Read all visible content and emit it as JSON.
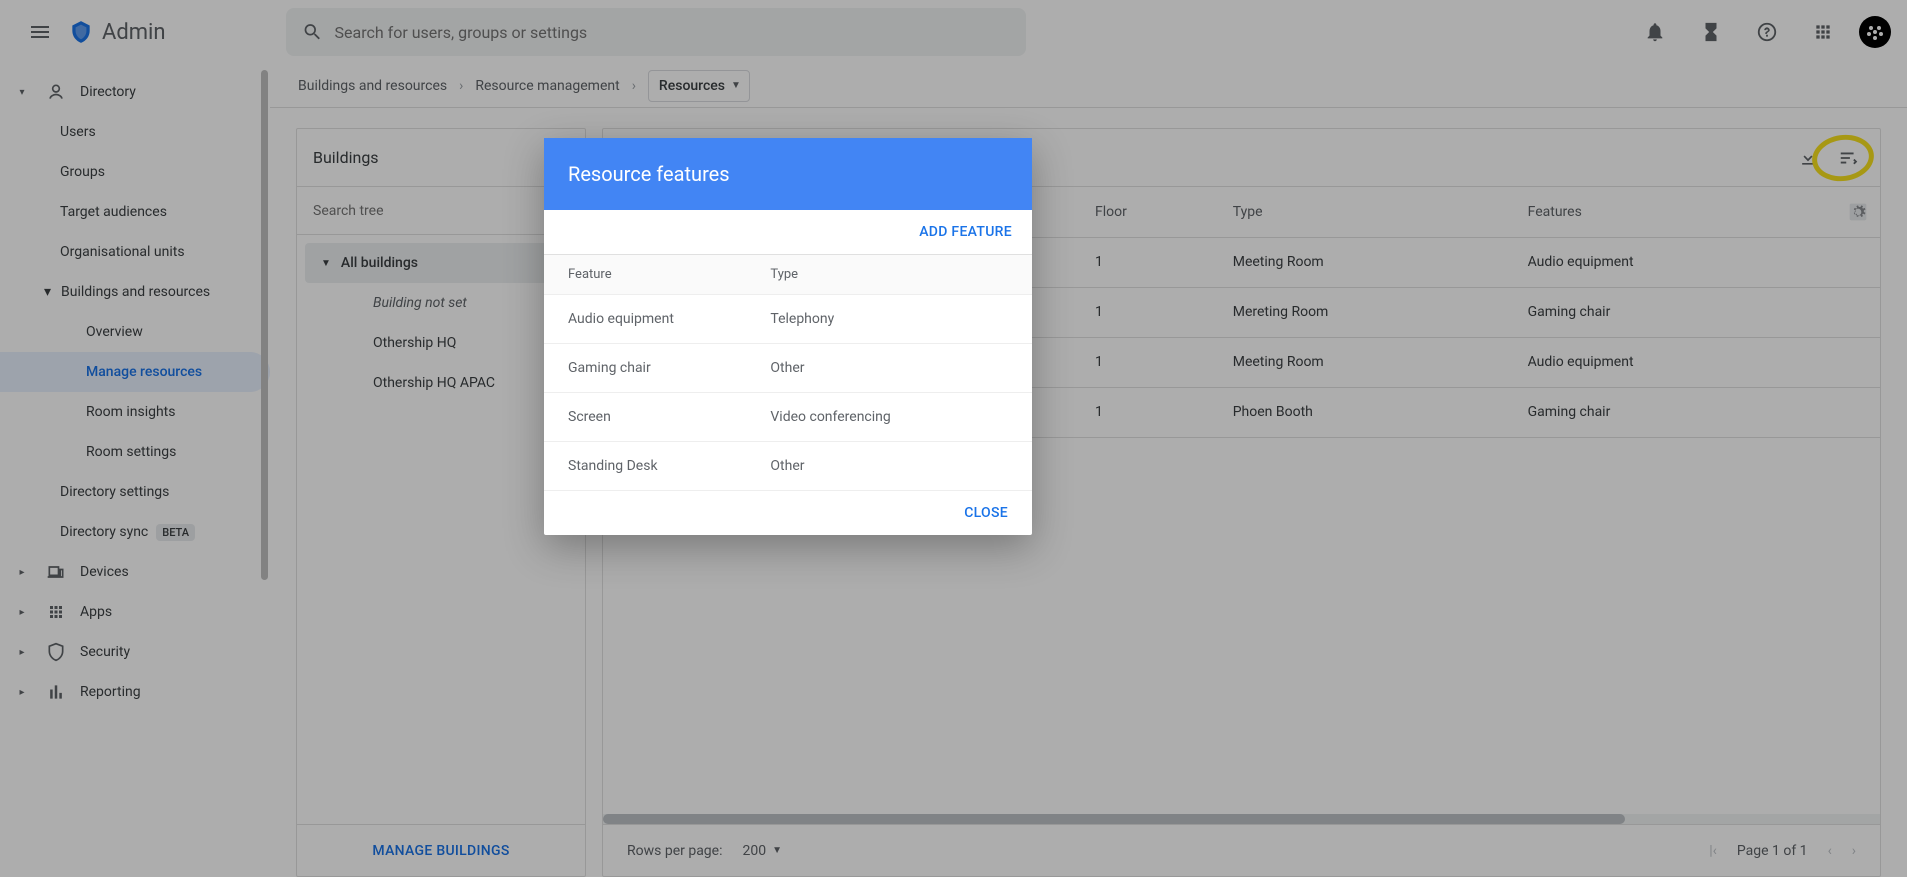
{
  "header": {
    "app_name": "Admin",
    "search_placeholder": "Search for users, groups or settings"
  },
  "sidebar": {
    "directory": "Directory",
    "users": "Users",
    "groups": "Groups",
    "target_audiences": "Target audiences",
    "org_units": "Organisational units",
    "buildings_resources": "Buildings and resources",
    "overview": "Overview",
    "manage_resources": "Manage resources",
    "room_insights": "Room insights",
    "room_settings": "Room settings",
    "directory_settings": "Directory settings",
    "directory_sync": "Directory sync",
    "beta": "BETA",
    "devices": "Devices",
    "apps": "Apps",
    "security": "Security",
    "reporting": "Reporting"
  },
  "breadcrumb": {
    "b0": "Buildings and resources",
    "b1": "Resource management",
    "b2": "Resources"
  },
  "buildings_panel": {
    "title": "Buildings",
    "search_placeholder": "Search tree",
    "all_buildings": "All buildings",
    "items": [
      "Building not set",
      "Othership HQ",
      "Othership HQ APAC"
    ],
    "manage": "MANAGE BUILDINGS"
  },
  "resources_panel": {
    "columns": {
      "floor": "Floor",
      "type": "Type",
      "features": "Features"
    },
    "rows": [
      {
        "floor": "1",
        "type": "Meeting Room",
        "features": "Audio equipment"
      },
      {
        "floor": "1",
        "type": "Mereting Room",
        "features": "Gaming chair"
      },
      {
        "floor": "1",
        "type": "Meeting Room",
        "features": "Audio equipment"
      },
      {
        "floor": "1",
        "type": "Phoen Booth",
        "features": "Gaming chair"
      }
    ],
    "rows_per_page_label": "Rows per page:",
    "rows_per_page_value": "200",
    "page_info": "Page 1 of 1"
  },
  "dialog": {
    "title": "Resource features",
    "add_feature": "ADD FEATURE",
    "col_feature": "Feature",
    "col_type": "Type",
    "rows": [
      {
        "feature": "Audio equipment",
        "type": "Telephony"
      },
      {
        "feature": "Gaming chair",
        "type": "Other"
      },
      {
        "feature": "Screen",
        "type": "Video conferencing"
      },
      {
        "feature": "Standing Desk",
        "type": "Other"
      }
    ],
    "close": "CLOSE"
  }
}
